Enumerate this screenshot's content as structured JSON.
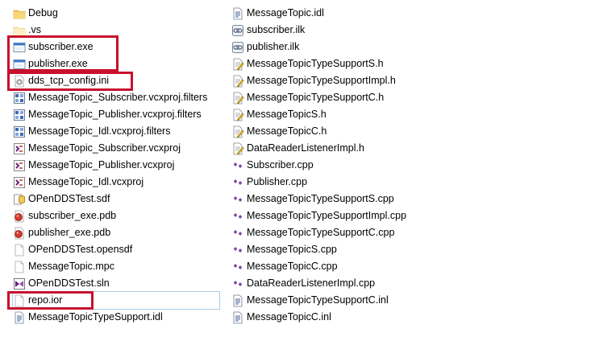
{
  "left_column": [
    {
      "name": "Debug",
      "icon": "folder-icon"
    },
    {
      "name": ".vs",
      "icon": "folder-light-icon"
    },
    {
      "name": "subscriber.exe",
      "icon": "exe-window-icon"
    },
    {
      "name": "publisher.exe",
      "icon": "exe-window-icon"
    },
    {
      "name": "dds_tcp_config.ini",
      "icon": "ini-gear-icon"
    },
    {
      "name": "MessageTopic_Subscriber.vcxproj.filters",
      "icon": "filters-grid-icon"
    },
    {
      "name": "MessageTopic_Publisher.vcxproj.filters",
      "icon": "filters-grid-icon"
    },
    {
      "name": "MessageTopic_Idl.vcxproj.filters",
      "icon": "filters-grid-icon"
    },
    {
      "name": "MessageTopic_Subscriber.vcxproj",
      "icon": "vcxproj-icon"
    },
    {
      "name": "MessageTopic_Publisher.vcxproj",
      "icon": "vcxproj-icon"
    },
    {
      "name": "MessageTopic_Idl.vcxproj",
      "icon": "vcxproj-icon"
    },
    {
      "name": "OPenDDSTest.sdf",
      "icon": "database-icon"
    },
    {
      "name": "subscriber_exe.pdb",
      "icon": "pdb-icon"
    },
    {
      "name": "publisher_exe.pdb",
      "icon": "pdb-icon"
    },
    {
      "name": "OPenDDSTest.opensdf",
      "icon": "blank-file-icon"
    },
    {
      "name": "MessageTopic.mpc",
      "icon": "blank-file-icon"
    },
    {
      "name": "OPenDDSTest.sln",
      "icon": "solution-icon"
    },
    {
      "name": "repo.ior",
      "icon": "blank-file-icon",
      "selected": true
    },
    {
      "name": "MessageTopicTypeSupport.idl",
      "icon": "text-file-icon"
    }
  ],
  "right_column": [
    {
      "name": "MessageTopic.idl",
      "icon": "text-file-icon"
    },
    {
      "name": "subscriber.ilk",
      "icon": "link-icon"
    },
    {
      "name": "publisher.ilk",
      "icon": "link-icon"
    },
    {
      "name": "MessageTopicTypeSupportS.h",
      "icon": "header-file-icon"
    },
    {
      "name": "MessageTopicTypeSupportImpl.h",
      "icon": "header-file-icon"
    },
    {
      "name": "MessageTopicTypeSupportC.h",
      "icon": "header-file-icon"
    },
    {
      "name": "MessageTopicS.h",
      "icon": "header-file-icon"
    },
    {
      "name": "MessageTopicC.h",
      "icon": "header-file-icon"
    },
    {
      "name": "DataReaderListenerImpl.h",
      "icon": "header-file-icon"
    },
    {
      "name": "Subscriber.cpp",
      "icon": "cpp-icon"
    },
    {
      "name": "Publisher.cpp",
      "icon": "cpp-icon"
    },
    {
      "name": "MessageTopicTypeSupportS.cpp",
      "icon": "cpp-icon"
    },
    {
      "name": "MessageTopicTypeSupportImpl.cpp",
      "icon": "cpp-icon"
    },
    {
      "name": "MessageTopicTypeSupportC.cpp",
      "icon": "cpp-icon"
    },
    {
      "name": "MessageTopicS.cpp",
      "icon": "cpp-icon"
    },
    {
      "name": "MessageTopicC.cpp",
      "icon": "cpp-icon"
    },
    {
      "name": "DataReaderListenerImpl.cpp",
      "icon": "cpp-icon"
    },
    {
      "name": "MessageTopicTypeSupportC.inl",
      "icon": "text-file-icon"
    },
    {
      "name": "MessageTopicC.inl",
      "icon": "text-file-icon"
    }
  ],
  "colors": {
    "highlight_box": "#c8102e",
    "selection_outline": "#a9cde8"
  }
}
